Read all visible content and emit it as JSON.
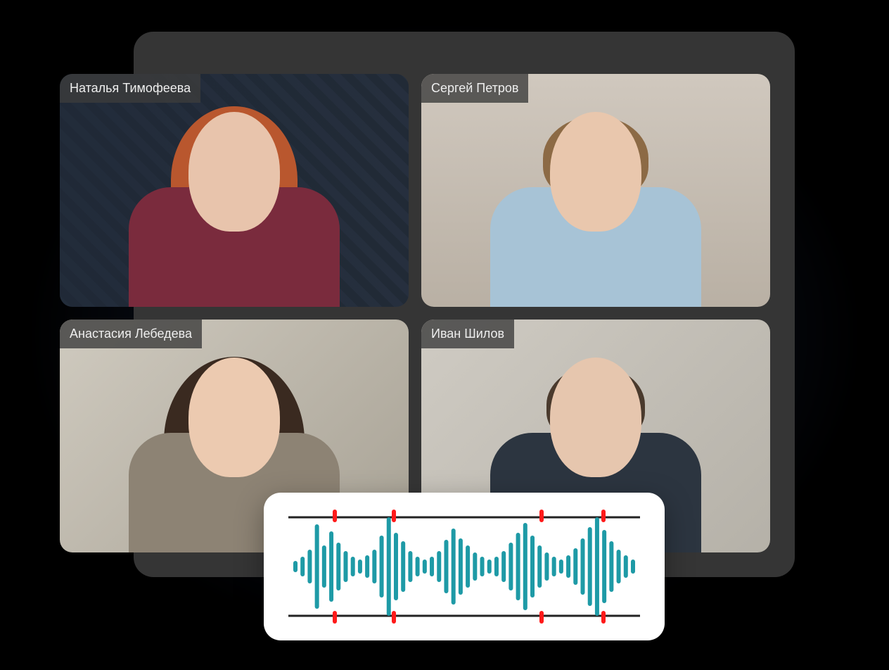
{
  "participants": [
    {
      "name": "Наталья Тимофеева"
    },
    {
      "name": "Сергей Петров"
    },
    {
      "name": "Анастасия Лебедева"
    },
    {
      "name": "Иван Шилов"
    }
  ],
  "waveform": {
    "color": "#1e9aa6",
    "marker_color": "#ff1a1a",
    "line_color": "#222222",
    "markers_x": [
      56,
      140,
      350,
      438
    ],
    "amplitudes": [
      8,
      14,
      24,
      60,
      30,
      50,
      34,
      22,
      14,
      10,
      16,
      24,
      44,
      70,
      48,
      36,
      22,
      14,
      10,
      14,
      22,
      38,
      54,
      40,
      30,
      20,
      14,
      10,
      14,
      22,
      34,
      48,
      62,
      44,
      30,
      20,
      14,
      10,
      16,
      26,
      40,
      56,
      70,
      52,
      36,
      24,
      16,
      10
    ]
  }
}
